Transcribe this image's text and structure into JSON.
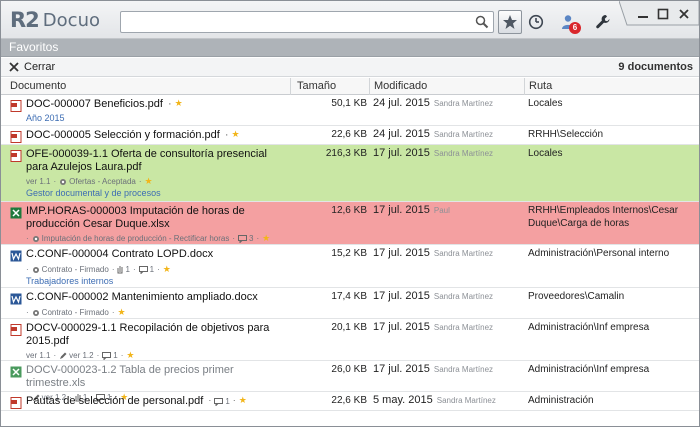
{
  "app": {
    "logo_r2": "R2",
    "logo_text": "Docuo"
  },
  "search": {
    "value": "",
    "placeholder": ""
  },
  "toolbar": {
    "notifications_badge": "6"
  },
  "section": {
    "title": "Favoritos",
    "close_label": "Cerrar",
    "count_label": "9 documentos"
  },
  "columns": {
    "document": "Documento",
    "size": "Tamaño",
    "modified": "Modificado",
    "route": "Ruta"
  },
  "rows": [
    {
      "title": "DOC-000007 Beneficios.pdf",
      "meta_star": "★",
      "sub": "Año 2015",
      "size": "50,1 KB",
      "date": "24 jul. 2015",
      "user": "Sandra Martínez",
      "route": "Locales"
    },
    {
      "title": "DOC-000005 Selección  y formación.pdf",
      "size": "22,6 KB",
      "date": "24 jul. 2015",
      "user": "Sandra Martínez",
      "route": "RRHH\\Selección"
    },
    {
      "title": "OFE-000039-1.1 Oferta de consultoría presencial para Azulejos Laura.pdf",
      "meta_version": "ver 1.1",
      "meta_workflow": "Ofertas - Aceptada",
      "sub": "Gestor documental y de procesos",
      "size": "216,3 KB",
      "date": "17 jul. 2015",
      "user": "Sandra Martínez",
      "route": "Locales"
    },
    {
      "title": "IMP.HORAS-000003 Imputación de horas de producción Cesar Duque.xlsx",
      "meta_workflow": "Imputación de horas de producción - Rectificar horas",
      "meta_comments": "3",
      "size": "12,6 KB",
      "date": "17 jul. 2015",
      "user": "Paul",
      "route": "RRHH\\Empleados Internos\\Cesar Duque\\Carga de horas"
    },
    {
      "title": "C.CONF-000004 Contrato LOPD.docx",
      "meta_workflow": "Contrato - Firmado",
      "meta_attachments": "1",
      "meta_comments": "1",
      "sub": "Trabajadores internos",
      "size": "15,2 KB",
      "date": "17 jul. 2015",
      "user": "Sandra Martínez",
      "route": "Administración\\Personal interno"
    },
    {
      "title": "C.CONF-000002 Mantenimiento ampliado.docx",
      "meta_workflow": "Contrato - Firmado",
      "size": "17,4 KB",
      "date": "17 jul. 2015",
      "user": "Sandra Martínez",
      "route": "Proveedores\\Camalin"
    },
    {
      "title": "DOCV-000029-1.1 Recopilación de objetivos para 2015.pdf",
      "meta_version": "ver 1.1",
      "meta_edit": "ver 1.2",
      "meta_comments": "1",
      "size": "20,1 KB",
      "date": "17 jul. 2015",
      "user": "Sandra Martínez",
      "route": "Administración\\Inf empresa"
    },
    {
      "title": "DOCV-000023-1.2 Tabla de precios primer trimestre.xls",
      "meta_edit": "ver 1.2",
      "meta_attachments": "1",
      "meta_comments": "1",
      "size": "26,0 KB",
      "date": "17 jul. 2015",
      "user": "Sandra Martínez",
      "route": "Administración\\Inf empresa"
    },
    {
      "title": "Pautas de selección de personal.pdf",
      "meta_comments": "1",
      "size": "22,6 KB",
      "date": "5 may. 2015",
      "user": "Sandra Martínez",
      "route": "Administración"
    }
  ],
  "colors": {
    "row_green": "#c9e7a4",
    "row_red": "#f4a0a1",
    "link_blue": "#3d6db3",
    "star": "#f2b51a"
  }
}
